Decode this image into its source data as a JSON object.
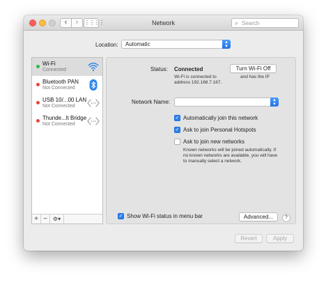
{
  "window": {
    "title": "Network"
  },
  "search": {
    "placeholder": "Search"
  },
  "location": {
    "label": "Location:",
    "value": "Automatic"
  },
  "networks": [
    {
      "name": "Wi-Fi",
      "status": "Connected",
      "status_color": "#2db84d",
      "icon": "wifi-icon",
      "selected": true
    },
    {
      "name": "Bluetooth PAN",
      "status": "Not Connected",
      "status_color": "#e8443a",
      "icon": "bluetooth-icon",
      "selected": false
    },
    {
      "name": "USB 10/...00 LAN",
      "status": "Not Connected",
      "status_color": "#e8443a",
      "icon": "ethernet-arrows-icon",
      "selected": false
    },
    {
      "name": "Thunde...lt Bridge",
      "status": "Not Connected",
      "status_color": "#e8443a",
      "icon": "ethernet-arrows-icon",
      "selected": false
    }
  ],
  "sidebar_tools": {
    "add": "+",
    "remove": "−",
    "action": "⚙▾"
  },
  "detail": {
    "status_label": "Status:",
    "status_value": "Connected",
    "status_description_1": "Wi-Fi is connected to",
    "status_description_2": "address 192.168.7.167.",
    "status_description_3": "and has the IP",
    "turn_off_button": "Turn Wi-Fi Off",
    "network_name_label": "Network Name:",
    "network_name_value": "",
    "options": [
      {
        "label": "Automatically join this network",
        "checked": true
      },
      {
        "label": "Ask to join Personal Hotspots",
        "checked": true
      },
      {
        "label": "Ask to join new networks",
        "checked": false
      }
    ],
    "ask_note_1": "Known networks will be joined automatically. If",
    "ask_note_2": "no known networks are available, you will have",
    "ask_note_3": "to manually select a network.",
    "show_status_label": "Show Wi-Fi status in menu bar",
    "show_status_checked": true,
    "advanced_button": "Advanced...",
    "help_button": "?"
  },
  "footer": {
    "revert_button": "Revert",
    "apply_button": "Apply"
  },
  "colors": {
    "accent": "#2d82ef",
    "connected": "#2db84d",
    "disconnected": "#e8443a"
  }
}
